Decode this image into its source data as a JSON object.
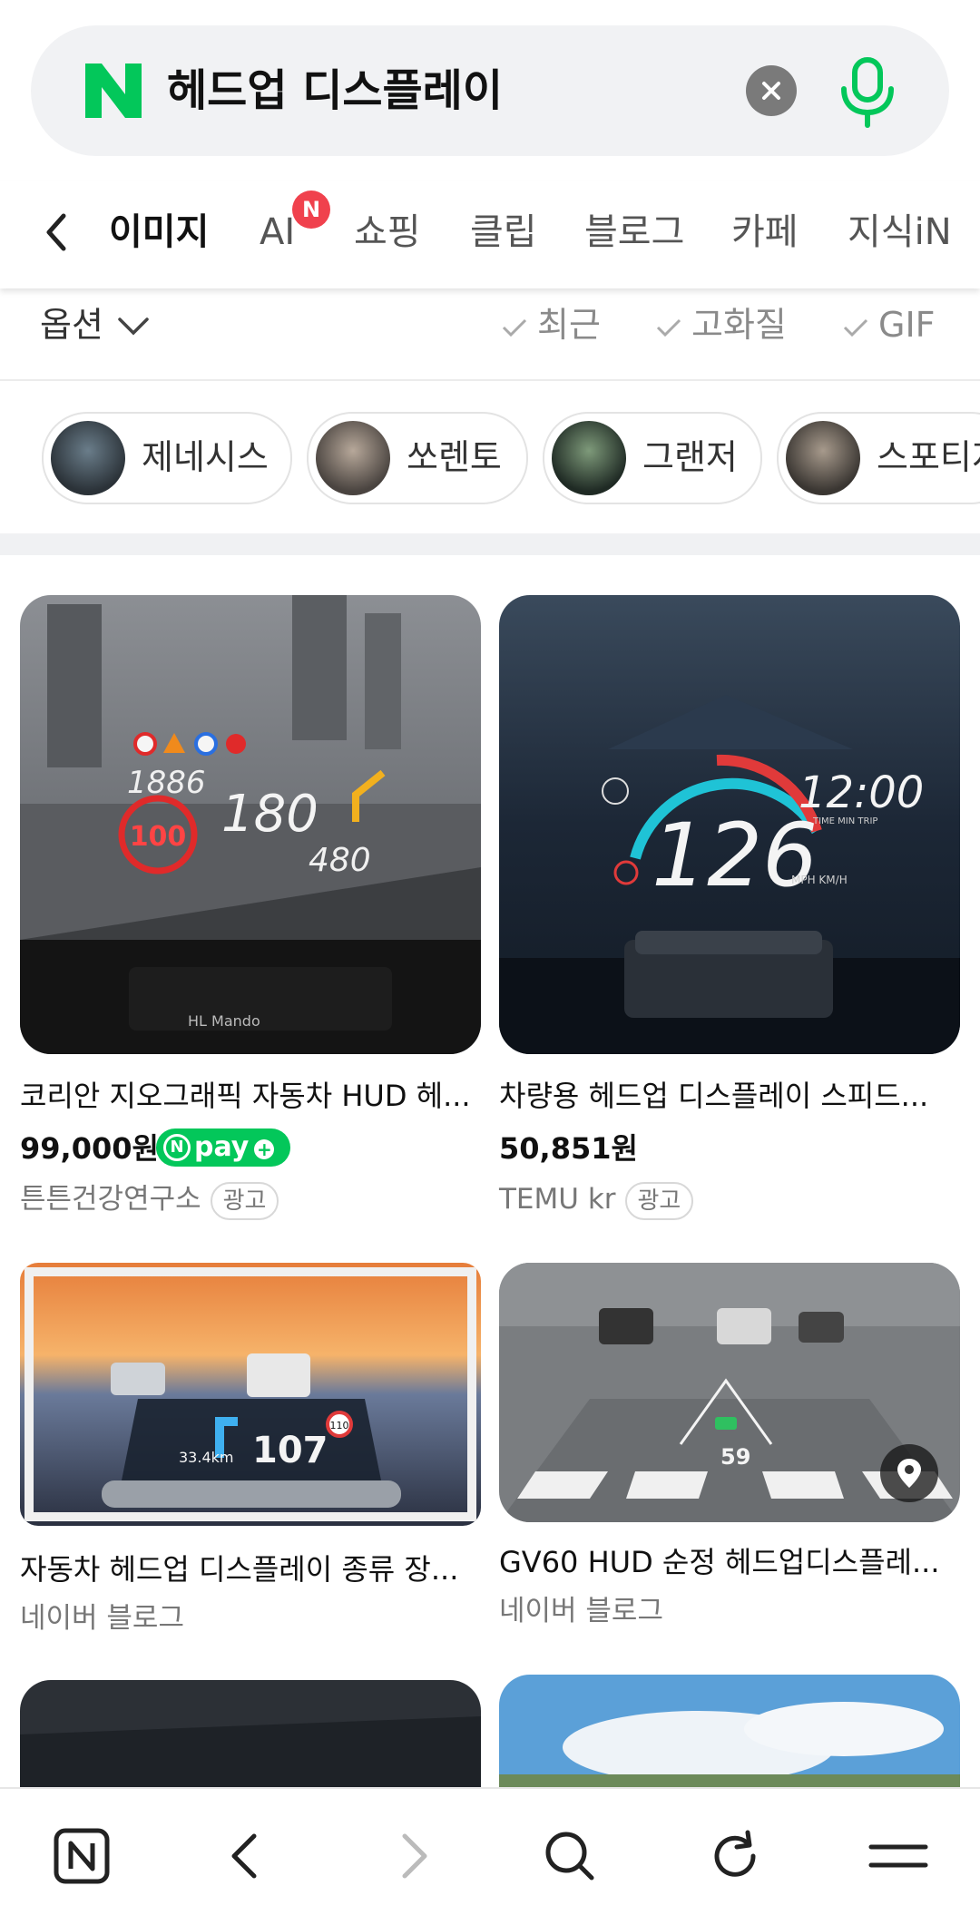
{
  "search": {
    "query": "헤드업 디스플레이",
    "logo": "N",
    "brand_color": "#03c75a"
  },
  "tabs": {
    "items": [
      "이미지",
      "AI",
      "쇼핑",
      "클립",
      "블로그",
      "카페",
      "지식iN"
    ],
    "active": "이미지",
    "ai_badge": "N"
  },
  "options": {
    "label": "옵션",
    "filters": [
      "최근",
      "고화질",
      "GIF"
    ]
  },
  "chips": [
    "제네시스",
    "쏘렌토",
    "그랜저",
    "스포티지"
  ],
  "results": [
    {
      "title": "코리안 지오그래픽 자동차 HUD 헤...",
      "price": "99,000원",
      "pay": "pay",
      "source": "튼튼건강연구소",
      "ad": "광고",
      "hud": {
        "a": "1886",
        "b": "180",
        "c": "480",
        "d": "100",
        "brand": "HL Mando"
      }
    },
    {
      "title": "차량용 헤드업 디스플레이 스피드...",
      "price": "50,851원",
      "source": "TEMU kr",
      "ad": "광고",
      "hud": {
        "speed": "126",
        "time": "12:00",
        "unit": "MPH KM/H",
        "trip": "TIME MIN TRIP"
      }
    },
    {
      "title": "자동차 헤드업 디스플레이 종류 장...",
      "source": "네이버 블로그",
      "hud": {
        "speed": "107",
        "dist": "33.4km",
        "limit": "110"
      }
    },
    {
      "title": "GV60 HUD 순정 헤드업디스플레...",
      "source": "네이버 블로그",
      "hud": {
        "speed": "59"
      }
    }
  ],
  "icons": [
    "search-clear-icon",
    "microphone-icon",
    "back-chevron-icon",
    "chevron-down-icon",
    "check-icon",
    "location-pin-icon",
    "naver-home-icon",
    "back-icon",
    "forward-icon",
    "search-icon",
    "refresh-icon",
    "menu-icon"
  ]
}
